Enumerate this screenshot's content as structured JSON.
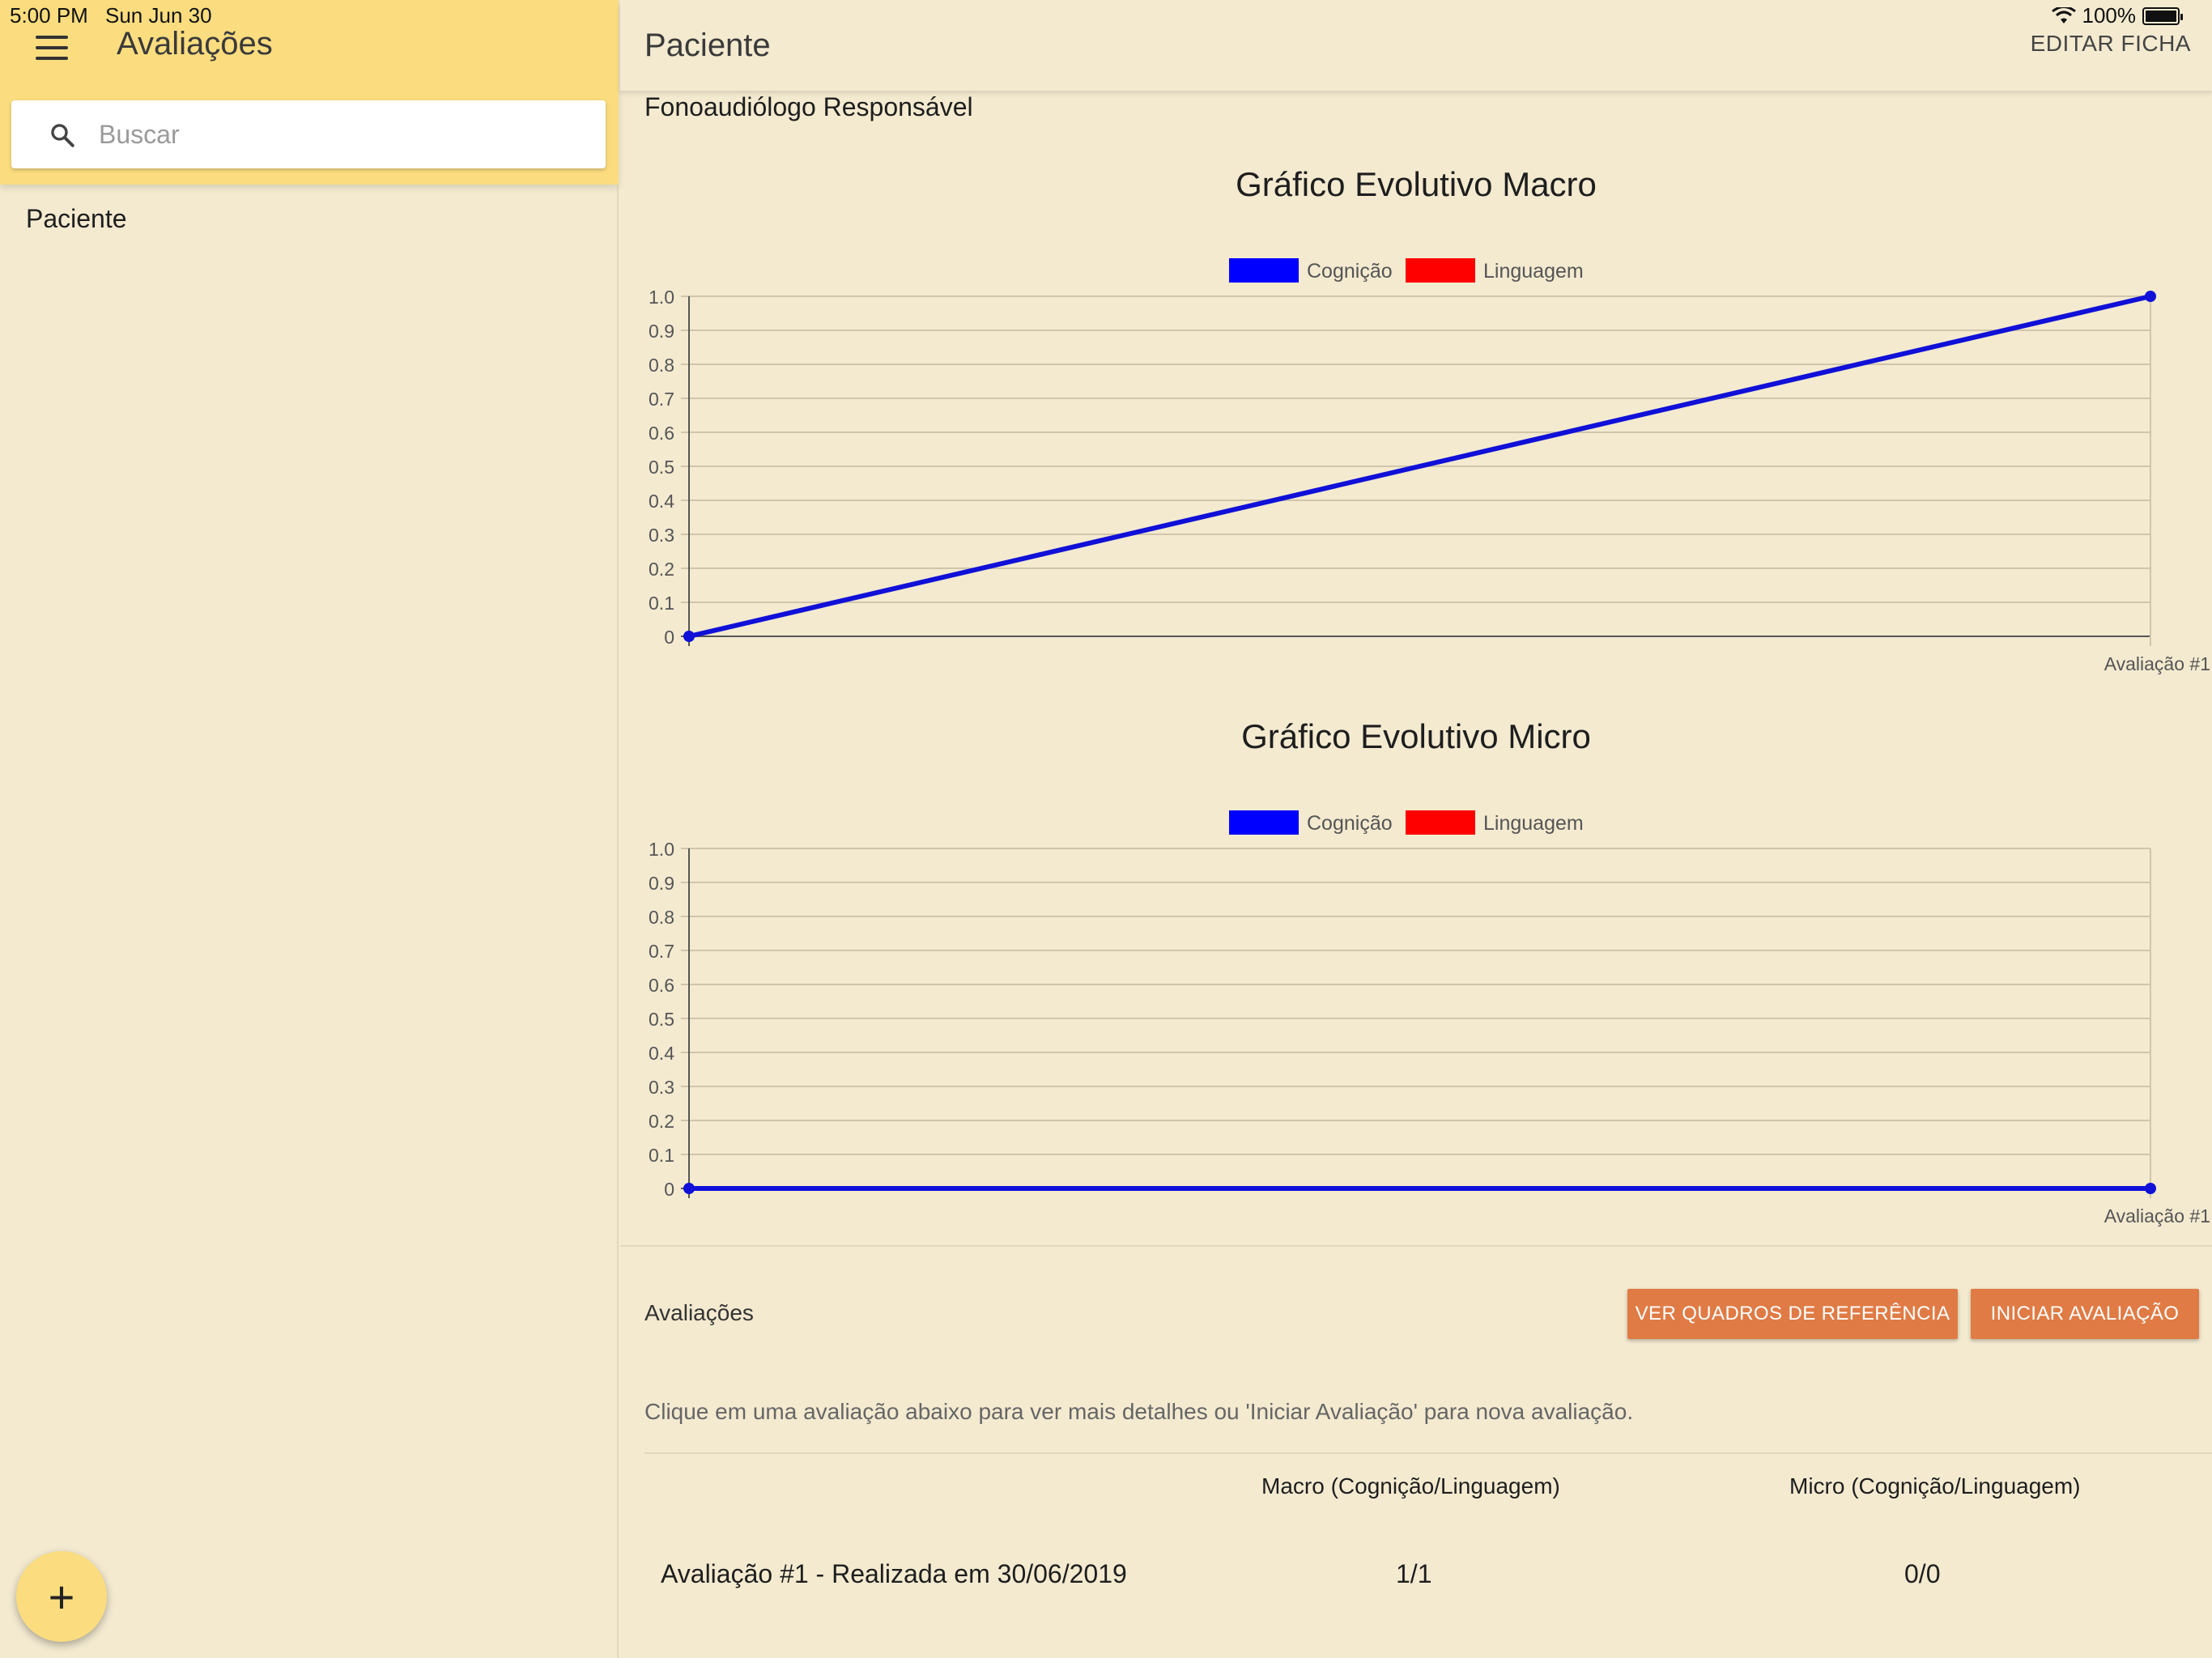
{
  "status": {
    "time": "5:00 PM",
    "date": "Sun Jun 30",
    "battery": "100%"
  },
  "sidebar": {
    "title": "Avaliações",
    "search_placeholder": "Buscar",
    "items": [
      {
        "label": "Paciente"
      }
    ],
    "fab_label": "+"
  },
  "header": {
    "title": "Paciente",
    "edit_label": "EDITAR FICHA"
  },
  "patient": {
    "fono_label": "Fonoaudiólogo Responsável"
  },
  "colors": {
    "series_cognicao": "#0000ff",
    "series_linguagem": "#ff0000",
    "sidebar_header": "#fbdd7f",
    "background": "#f3ead0",
    "button": "#e07b45"
  },
  "chart_data": [
    {
      "type": "line",
      "title": "Gráfico Evolutivo Macro",
      "legend": [
        "Cognição",
        "Linguagem"
      ],
      "legend_position": "top",
      "x": [
        "",
        "Avaliação #1"
      ],
      "series": [
        {
          "name": "Cognição",
          "color": "#0000ff",
          "values": [
            0,
            1
          ]
        },
        {
          "name": "Linguagem",
          "color": "#ff0000",
          "values": []
        }
      ],
      "ylim": [
        0,
        1
      ],
      "yticks": [
        "0",
        "0.1",
        "0.2",
        "0.3",
        "0.4",
        "0.5",
        "0.6",
        "0.7",
        "0.8",
        "0.9",
        "1.0"
      ],
      "grid": true
    },
    {
      "type": "line",
      "title": "Gráfico Evolutivo Micro",
      "legend": [
        "Cognição",
        "Linguagem"
      ],
      "legend_position": "top",
      "x": [
        "",
        "Avaliação #1"
      ],
      "series": [
        {
          "name": "Cognição",
          "color": "#0000ff",
          "values": [
            0,
            0
          ]
        },
        {
          "name": "Linguagem",
          "color": "#ff0000",
          "values": []
        }
      ],
      "ylim": [
        0,
        1
      ],
      "yticks": [
        "0",
        "0.1",
        "0.2",
        "0.3",
        "0.4",
        "0.5",
        "0.6",
        "0.7",
        "0.8",
        "0.9",
        "1.0"
      ],
      "grid": true
    }
  ],
  "evaluations": {
    "section_title": "Avaliações",
    "ref_button": "VER QUADROS DE REFERÊNCIA",
    "start_button": "INICIAR AVALIAÇÃO",
    "hint": "Clique em uma avaliação abaixo para ver mais detalhes ou 'Iniciar Avaliação' para nova avaliação.",
    "columns": [
      "Macro (Cognição/Linguagem)",
      "Micro (Cognição/Linguagem)"
    ],
    "rows": [
      {
        "name": "Avaliação #1 - Realizada em 30/06/2019",
        "macro": "1/1",
        "micro": "0/0"
      }
    ]
  }
}
